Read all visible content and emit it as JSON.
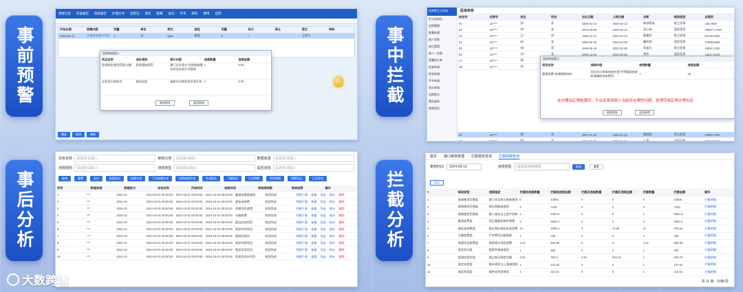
{
  "labels": {
    "pre_warning": "事前预警",
    "in_intercept": "事中拦截",
    "post_analysis": "事后分析",
    "intercept_analysis": "拦截分析"
  },
  "brand": "大数跨境",
  "panel1": {
    "toolbar": [
      "患者信息",
      "检查报告",
      "检验报告",
      "护理文书",
      "住院证",
      "病历",
      "医嘱",
      "会诊",
      "手术",
      "转科",
      "费用",
      "出院"
    ],
    "grid_headers": [
      "开始日期",
      "医嘱内容",
      "剂量",
      "单位",
      "频次",
      "途径",
      "用量",
      "执行",
      "停止",
      "医生",
      "审核"
    ],
    "dialog_headers": [
      "药品名称",
      "违反规则",
      "提示内容",
      "违规数量",
      "违规金额"
    ],
    "dialog_rows": [
      [
        "医保限定使用范围·口服",
        "医保限制用药",
        "限门诊及急诊·住院患者需符合适应症方可报销",
        "1",
        "5.50"
      ],
      [
        "注射用头孢呋辛",
        "超适应症",
        "请核对诊断信息后再开具",
        "1",
        "8.00"
      ]
    ],
    "btn_confirm": "继续保存",
    "btn_cancel": "返回修改",
    "footer_buttons": [
      "确定",
      "取消",
      "刷新"
    ]
  },
  "panel2": {
    "app_title": "住院医生工作站",
    "title": "医保审核",
    "sidebar": [
      "护士站待办",
      "出院管理",
      "医嘱处理",
      "病人列表",
      "床位管理",
      "病人一览表",
      "医嘱执行单",
      "检查申请",
      "检验申请",
      "手术申请",
      "会诊申请",
      "出院登记",
      "费用清单",
      "病案首页"
    ],
    "headers": [
      "床位号",
      "住院号",
      "姓名",
      "性别",
      "出生日期",
      "入院日期",
      "诊断",
      "医保类型",
      "总费用"
    ],
    "rows": [
      [
        "01",
        "18****",
        "张*",
        "男",
        "1965-01-14",
        "2023-02-13",
        "肺部感染",
        "职工医保",
        "156.0000"
      ],
      [
        "02",
        "18****",
        "李*",
        "女",
        "1972-03-09",
        "2023-02-12",
        "冠心病",
        "居民医保",
        "196877.4700"
      ],
      [
        "03",
        "18****",
        "王*",
        "男",
        "1958-11-22",
        "2023-02-10",
        "脑梗死",
        "职工医保",
        "84786.2800"
      ],
      [
        "04",
        "18****",
        "赵*",
        "女",
        "1980-06-30",
        "2023-02-09",
        "糖尿病",
        "居民医保",
        "37698.5900"
      ],
      [
        "05",
        "18****",
        "钱*",
        "男",
        "1949-09-18",
        "2023-02-08",
        "高血压",
        "职工医保",
        "24591.2200"
      ],
      [
        "06",
        "18****",
        "孙*",
        "女",
        "1990-12-03",
        "2023-02-06",
        "骨折",
        "居民医保",
        "15327.8100"
      ],
      [
        "07",
        "18****",
        "周*",
        "男",
        "1962-04-27",
        "2023-02-05",
        "肺炎",
        "职工医保",
        "9856.6400"
      ],
      [
        "08",
        "18****",
        "吴*",
        "女",
        "1975-08-11",
        "2023-02-04",
        "胃炎",
        "居民医保",
        "7628.4300"
      ]
    ],
    "rows_bottom": [
      [
        "21",
        "18****",
        "郑*",
        "男",
        "1957-01-19",
        "2023-01-22",
        "慢阻肺",
        "职工医保",
        "34982.7500"
      ],
      [
        "22",
        "18****",
        "陈*",
        "女",
        "1966-05-08",
        "2023-01-21",
        "心衰",
        "居民医保",
        "28764.0200"
      ],
      [
        "23",
        "18****",
        "刘*",
        "男",
        "1970-10-15",
        "2023-01-20",
        "胆囊炎",
        "职工医保",
        "19857.3600"
      ],
      [
        "24",
        "18****",
        "黄*",
        "女",
        "1983-02-24",
        "2023-01-18",
        "肾结石",
        "居民医保",
        "8843.9900"
      ]
    ],
    "dialog_headers": [
      "项目名称",
      "违规内容",
      "违规数量",
      "违规金额"
    ],
    "dialog_row": [
      "重复收费-机械辅助排痰",
      "同日内已收取排痰护理·不得重复收取机械辅助排痰费用",
      "1",
      "23"
    ],
    "notice": "在办理出区预结算时，平台反馈该病人当前存在哪些问题，处理完成后再办理出区",
    "btn_confirm": "继续保存",
    "btn_cancel": "返回修改"
  },
  "panel3": {
    "filters": [
      "任务名称",
      "审核分类",
      "数据来源",
      "违规规则",
      "违规类型",
      "是否违规"
    ],
    "placeholder": "请选择/请输入",
    "buttons": [
      "查询",
      "重置",
      "导出",
      "批量导出",
      "结果生成",
      "门诊结果生成",
      "住院结果生成",
      "生成报告",
      "下载报告",
      "门诊明细",
      "住院明细",
      "明细导出",
      "汇总导出"
    ],
    "headers": [
      "序号",
      "数据来源",
      "数据批次",
      "任务名称",
      "开始时间",
      "结束时间",
      "审核规则数",
      "审核结果",
      "操作"
    ],
    "rows": [
      [
        "1",
        "***",
        "2024-10",
        "2024-10-01 00:00:00",
        "2024-10-01 00:00:00",
        "2024-10-01 00:00:00",
        "重复收费类规则",
        "检测完成"
      ],
      [
        "2",
        "***",
        "2024-10",
        "2024-10-01 00:00:00",
        "2024-10-01 00:00:00",
        "2024-10-01 00:00:00",
        "超标准收费",
        "检测完成"
      ],
      [
        "3",
        "***",
        "2024-10",
        "2024-10-01 00:00:00",
        "2024-10-01 00:00:00",
        "2024-10-01 00:00:00",
        "串换项目收费",
        "检测完成"
      ],
      [
        "4",
        "***",
        "2024-10",
        "2024-10-01 00:00:00",
        "2024-10-01 00:00:00",
        "2024-10-01 00:00:00",
        "分解收费",
        "检测完成"
      ],
      [
        "5",
        "***",
        "2024-10",
        "2024-10-01 00:00:00",
        "2024-10-01 00:00:00",
        "2024-10-01 00:00:00",
        "超适应症用药",
        "检测完成"
      ],
      [
        "6",
        "***",
        "2024-10",
        "2024-10-01 00:00:00",
        "2024-10-01 00:00:00",
        "2024-10-01 00:00:00",
        "限定性别项目",
        "检测完成"
      ],
      [
        "7",
        "***",
        "2024-10",
        "2024-10-01 00:00:00",
        "2024-10-01 00:00:00",
        "2024-10-01 00:00:00",
        "超限定频次",
        "检测完成"
      ],
      [
        "8",
        "***",
        "2024-10",
        "2024-10-01 00:00:00",
        "2024-10-01 00:00:00",
        "2024-10-01 00:00:00",
        "限定年龄项目",
        "检测完成"
      ],
      [
        "9",
        "***",
        "2024-10",
        "2024-10-01 00:00:00",
        "2024-10-01 00:00:00",
        "2024-10-01 00:00:00",
        "限定科室项目",
        "检测完成"
      ],
      [
        "10",
        "***",
        "2024-10",
        "2024-10-01 00:00:00",
        "2024-10-01 00:00:00",
        "2024-10-01 00:00:00",
        "医保目录外项目",
        "检测完成"
      ]
    ],
    "ops": [
      "明细下载",
      "查看",
      "导出",
      "统计"
    ],
    "op_delete": "删除"
  },
  "panel4": {
    "tabs": [
      "首页",
      "接口审核管理",
      "拦截报告查询",
      "拦截明细查询"
    ],
    "filter_date_label": "审核时间",
    "filter_date": "2024-09-13",
    "filter_type_label": "违规类型",
    "filter_type_placeholder": "请选择违规类型",
    "btn_query": "查询",
    "btn_reset": "重置",
    "btn_export": "导出",
    "headers": [
      "#",
      "规则类型",
      "违规描述",
      "拦截前违规数量",
      "拦截前违规金额",
      "拦截后违规数量",
      "拦截后违规金额",
      "拦截数量",
      "拦截金额",
      "操作"
    ],
    "rows": [
      [
        "1",
        "限制使用范围类",
        "限门诊及急诊患者使用",
        "0",
        "10000",
        "0",
        "0",
        "0",
        "10000"
      ],
      [
        "2",
        "限制使用范围类",
        "限住院患者使用",
        "2",
        "7100",
        "0",
        "0",
        "0",
        "7100"
      ],
      [
        "3",
        "限制使用范围类",
        "限二级及以上医疗机构",
        "1",
        "5452.6",
        "0",
        "0",
        "1",
        "5452.6"
      ],
      [
        "4",
        "重复收费类",
        "同日重复收取护理费",
        "5",
        "3250.4",
        "0",
        "0",
        "5",
        "3250.4"
      ],
      [
        "5",
        "超标准收费类",
        "超过物价规定标准收费",
        "14",
        "1050.4",
        "3",
        "74.56",
        "11",
        "975.84"
      ],
      [
        "6",
        "分解收费类",
        "手术费用分解收取",
        "1",
        "786",
        "0",
        "0",
        "1",
        "786"
      ],
      [
        "7",
        "串换项目收费类",
        "串换高价项目收费",
        "2.12",
        "652.96",
        "0",
        "0",
        "2.12",
        "652.96"
      ],
      [
        "8",
        "限定性别类",
        "限男性患者使用",
        "1",
        "450",
        "0",
        "0",
        "1",
        "450"
      ],
      [
        "9",
        "超限定频次类",
        "超过每日限定次数",
        "3.51",
        "784.9",
        "4.51",
        "624.14",
        "1",
        "160.76"
      ],
      [
        "10",
        "限定年龄类",
        "限18周岁以上患者使用",
        "1",
        "137.92",
        "0",
        "0",
        "1",
        "137.92"
      ],
      [
        "11",
        "限定科室类",
        "限特定科室使用",
        "1",
        "110.34",
        "0",
        "0",
        "1",
        "110.34"
      ]
    ],
    "op_label": "拦截明细",
    "pager": "共 11 条 · 10条/页"
  }
}
